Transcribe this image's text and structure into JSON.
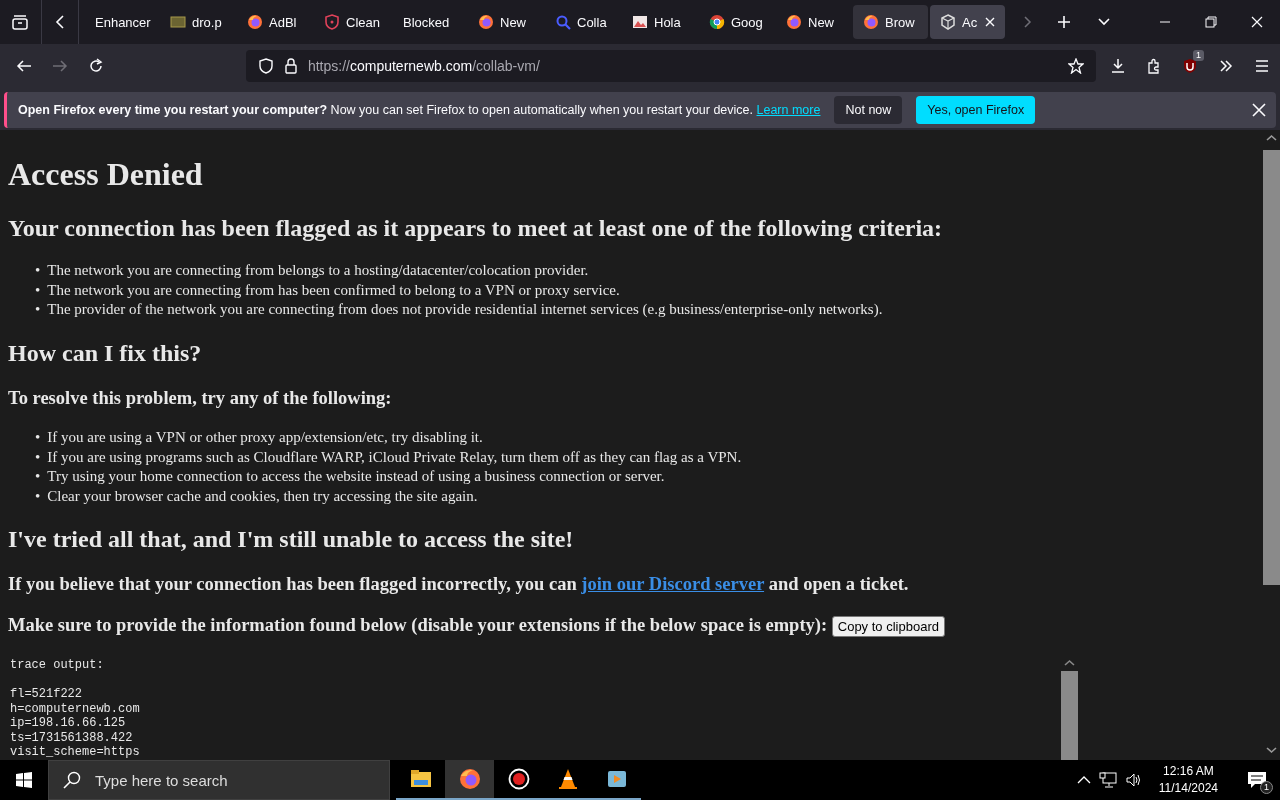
{
  "tabs": [
    {
      "label": "Enhancer",
      "kind": "none",
      "selected": false,
      "hovered": false
    },
    {
      "label": "dro.p",
      "kind": "folder",
      "selected": false,
      "hovered": false
    },
    {
      "label": "AdBl",
      "kind": "firefox",
      "selected": false,
      "hovered": false
    },
    {
      "label": "Clean",
      "kind": "shield",
      "selected": false,
      "hovered": false
    },
    {
      "label": "Blocked",
      "kind": "none",
      "selected": false,
      "hovered": false
    },
    {
      "label": "New",
      "kind": "firefox",
      "selected": false,
      "hovered": false
    },
    {
      "label": "Colla",
      "kind": "search",
      "selected": false,
      "hovered": false
    },
    {
      "label": "Hola",
      "kind": "image",
      "selected": false,
      "hovered": false
    },
    {
      "label": "Goog",
      "kind": "chrome",
      "selected": false,
      "hovered": false
    },
    {
      "label": "New",
      "kind": "firefox",
      "selected": false,
      "hovered": false
    },
    {
      "label": "Brow",
      "kind": "firefox",
      "selected": false,
      "hovered": true
    },
    {
      "label": "Ac",
      "kind": "cube",
      "selected": true,
      "hovered": false
    }
  ],
  "address_bar": {
    "scheme": "https://",
    "host": "computernewb.com",
    "path": "/collab-vm/"
  },
  "extension_badge": "1",
  "notification": {
    "title": "Open Firefox every time you restart your computer?",
    "message": "Now you can set Firefox to open automatically when you restart your device.",
    "link": "Learn more",
    "buttons": [
      {
        "label": "Not now",
        "kind": "secondary"
      },
      {
        "label": "Yes, open Firefox",
        "kind": "primary"
      }
    ]
  },
  "page": {
    "title": "Access Denied",
    "bullet": "•",
    "heading": "Your connection has been flagged as it appears to meet at least one of the following criteria:",
    "criteria": [
      "The network you are connecting from belongs to a hosting/datacenter/colocation provider.",
      "The network you are connecting from has been confirmed to belong to a VPN or proxy service.",
      "The provider of the network you are connecting from does not provide residential internet services (e.g business/enterprise-only networks)."
    ],
    "fix_heading": "How can I fix this?",
    "fix_intro": "To resolve this problem, try any of the following:",
    "fixes": [
      "If you are using a VPN or other proxy app/extension/etc, try disabling it.",
      "If you are using programs such as Cloudflare WARP, iCloud Private Relay, turn them off as they can flag as a VPN.",
      "Try using your home connection to access the website instead of using a business connection or server.",
      "Clear your browser cache and cookies, then try accessing the site again."
    ],
    "tried_heading": "I've tried all that, and I'm still unable to access the site!",
    "discord": {
      "before": "If you believe that your connection has been flagged incorrectly, you can",
      "link": "join our Discord server",
      "after": "and open a ticket."
    },
    "info_prompt": "Make sure to provide the information found below (disable your extensions if the below space is empty):",
    "copy_button": "Copy to clipboard",
    "trace_title": "trace output:",
    "trace_lines": [
      "fl=521f222",
      "h=computernewb.com",
      "ip=198.16.66.125",
      "ts=1731561388.422",
      "visit_scheme=https"
    ]
  },
  "taskbar": {
    "search": {
      "placeholder": "Type here to search"
    },
    "apps": [
      {
        "kind": "folder",
        "active": false
      },
      {
        "kind": "firefox",
        "active": true
      },
      {
        "kind": "record",
        "active": false
      },
      {
        "kind": "cone",
        "active": false
      },
      {
        "kind": "player",
        "active": false
      }
    ],
    "time": "12:16 AM",
    "date": "11/14/2024",
    "notification_count": "1"
  }
}
